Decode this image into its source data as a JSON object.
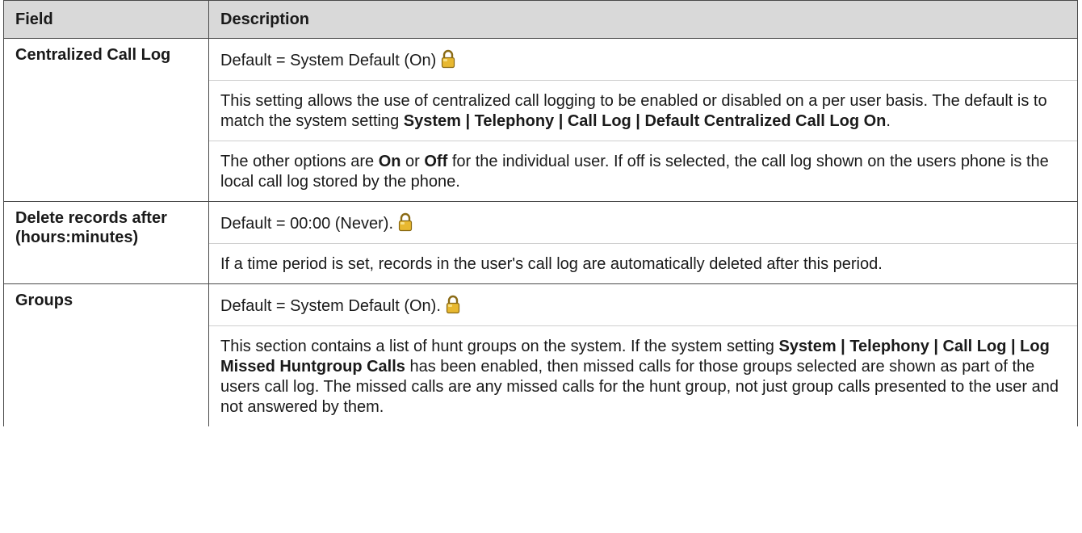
{
  "table": {
    "headers": {
      "field": "Field",
      "description": "Description"
    },
    "rows": [
      {
        "field": "Centralized Call Log",
        "default": "Default = System Default (On)",
        "lock_icon": "lock-icon",
        "p1": {
          "a": "This setting allows the use of centralized call logging to be enabled or disabled on a per user basis. The default is to match the system setting ",
          "b": "System | Telephony | Call Log | Default Centralized Call Log On",
          "c": "."
        },
        "p2": {
          "a": "The other options are ",
          "b": "On",
          "c": " or ",
          "d": "Off",
          "e": " for the individual user. If off is selected, the call log shown on the users phone is the local call log stored by the phone."
        }
      },
      {
        "field": "Delete records after (hours:minutes)",
        "default": "Default = 00:00 (Never).",
        "lock_icon": "lock-icon",
        "p1": "If a time period is set, records in the user's call log are automatically deleted after this period."
      },
      {
        "field": "Groups",
        "default": "Default = System Default (On).",
        "lock_icon": "lock-icon",
        "p1": {
          "a": "This section contains a list of hunt groups on the system. If the system setting ",
          "b": "System | Telephony | Call Log | Log Missed Huntgroup Calls",
          "c": " has been enabled, then missed calls for those groups selected are shown as part of the users call log. The missed calls are any missed calls for the hunt group, not just group calls presented to the user and not answered by them."
        }
      }
    ]
  }
}
